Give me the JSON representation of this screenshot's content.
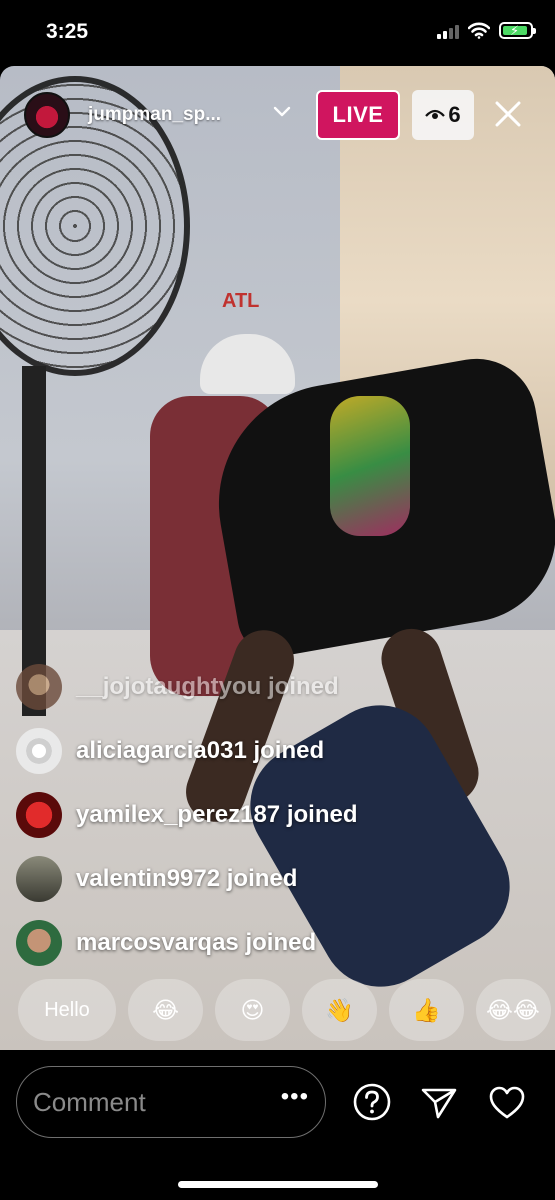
{
  "status_bar": {
    "time": "3:25"
  },
  "header": {
    "username": "jumpman_sp...",
    "live_label": "LIVE",
    "viewer_count": "6"
  },
  "joins": [
    {
      "username": "__jojotaughtyou",
      "action": " joined"
    },
    {
      "username": "aliciagarcia031",
      "action": " joined"
    },
    {
      "username": "yamilex_perez187",
      "action": " joined"
    },
    {
      "username": "valentin9972",
      "action": " joined"
    },
    {
      "username": "marcosvarqas",
      "action": " joined"
    }
  ],
  "quick_reactions": [
    "Hello",
    "😂",
    "😍",
    "👋",
    "👍",
    "😂😂"
  ],
  "comment_bar": {
    "placeholder": "Comment",
    "more": "•••"
  },
  "video_overlay": {
    "cap_text": "ATL"
  },
  "colors": {
    "live_badge": "#d0155f",
    "battery": "#4cd964"
  },
  "icons": [
    "signal-icon",
    "wifi-icon",
    "battery-icon",
    "chevron-down-icon",
    "eye-icon",
    "close-icon",
    "question-icon",
    "send-icon",
    "heart-icon"
  ]
}
